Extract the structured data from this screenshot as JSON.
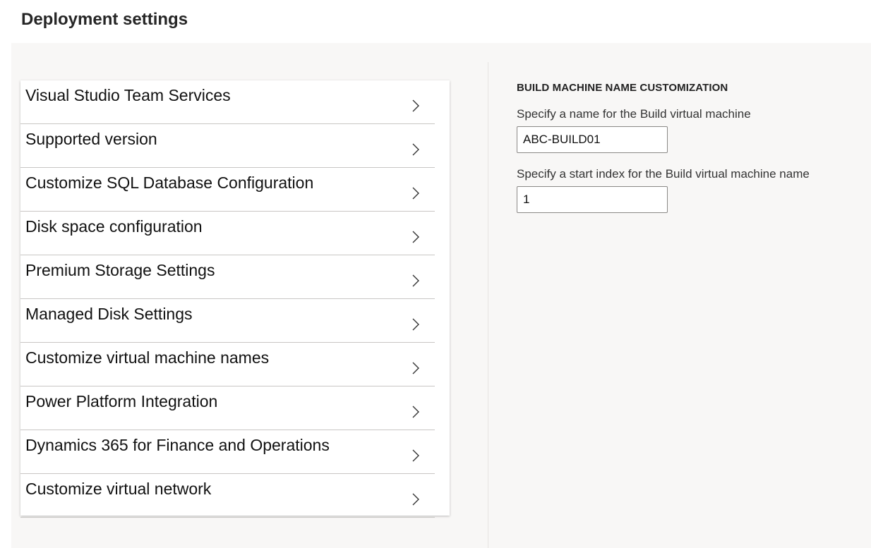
{
  "page": {
    "title": "Deployment settings"
  },
  "nav": {
    "items": [
      {
        "label": "Visual Studio Team Services"
      },
      {
        "label": "Supported version"
      },
      {
        "label": "Customize SQL Database Configuration"
      },
      {
        "label": "Disk space configuration"
      },
      {
        "label": "Premium Storage Settings"
      },
      {
        "label": "Managed Disk Settings"
      },
      {
        "label": "Customize virtual machine names"
      },
      {
        "label": "Power Platform Integration"
      },
      {
        "label": "Dynamics 365 for Finance and Operations"
      },
      {
        "label": "Customize virtual network"
      }
    ],
    "chevron_icon": "chevron-right-icon"
  },
  "details": {
    "heading": "BUILD MACHINE NAME CUSTOMIZATION",
    "name_field": {
      "label": "Specify a name for the Build virtual machine",
      "value": "ABC-BUILD01"
    },
    "index_field": {
      "label": "Specify a start index for the Build virtual machine name",
      "value": "1"
    }
  },
  "colors": {
    "page_background": "#ffffff",
    "content_background": "#f8f7f6",
    "panel_background": "#ffffff",
    "divider": "#c8c6c4",
    "input_border": "#8a8886"
  }
}
